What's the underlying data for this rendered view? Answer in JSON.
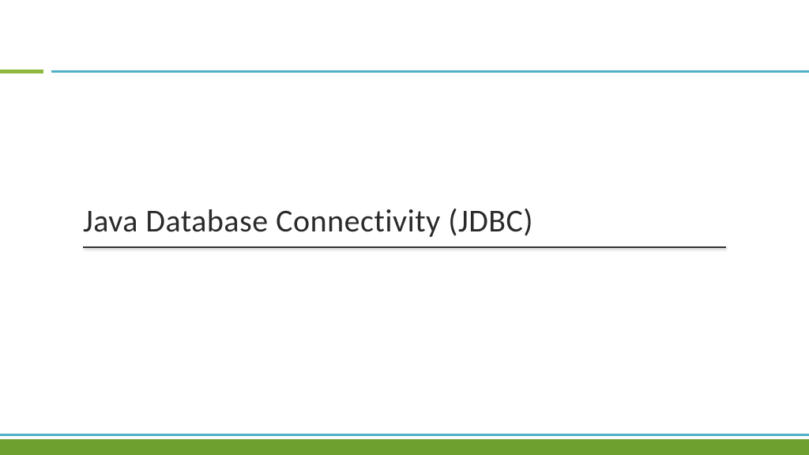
{
  "slide": {
    "title": "Java Database Connectivity (JDBC)"
  },
  "theme": {
    "accent_blue": "#4fb0c6",
    "accent_green": "#8fb93e",
    "footer_green": "#6ea030"
  }
}
